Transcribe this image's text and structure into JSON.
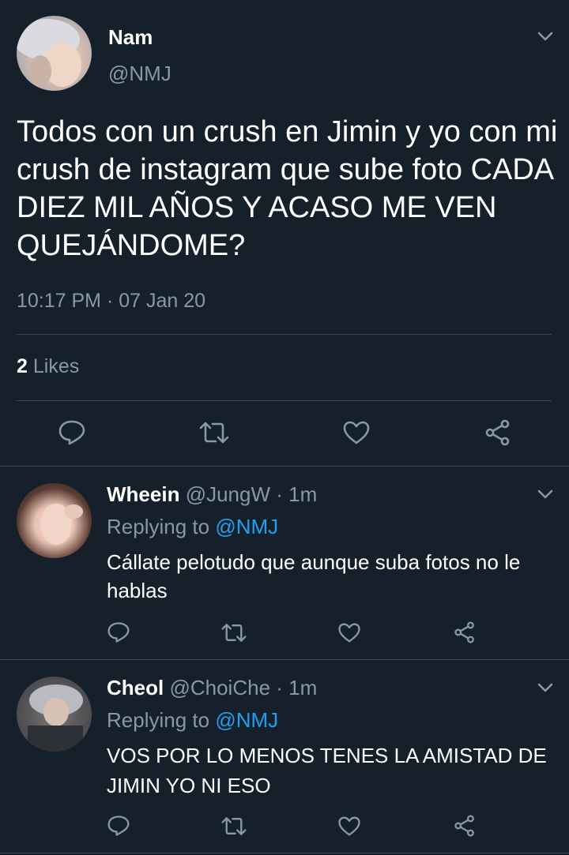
{
  "colors": {
    "background": "#15202b",
    "text": "#ffffff",
    "secondary": "#8899a6",
    "accent": "#1da1f2",
    "divider": "#38444d"
  },
  "main_tweet": {
    "name": "Nam",
    "handle": "@NMJ",
    "text": "Todos con un crush en Jimin y yo con mi crush de instagram que sube foto CADA DIEZ MIL AÑOS Y ACASO ME VEN QUEJÁNDOME?",
    "timestamp": "10:17 PM · 07 Jan 20",
    "likes_count": "2",
    "likes_label": "Likes"
  },
  "replies": [
    {
      "name": "Wheein",
      "handle": "@JungW",
      "time": "· 1m",
      "replying_label": "Replying to",
      "replying_handle": "@NMJ",
      "text": "Cállate pelotudo que aunque suba fotos no le hablas"
    },
    {
      "name": "Cheol",
      "handle": "@ChoiChe",
      "time": "· 1m",
      "replying_label": "Replying to",
      "replying_handle": "@NMJ",
      "text": "VOS POR LO MENOS TENES LA AMISTAD DE JIMIN YO NI ESO"
    }
  ],
  "icons": [
    "chevron-down-icon",
    "reply-icon",
    "retweet-icon",
    "like-icon",
    "share-icon"
  ]
}
